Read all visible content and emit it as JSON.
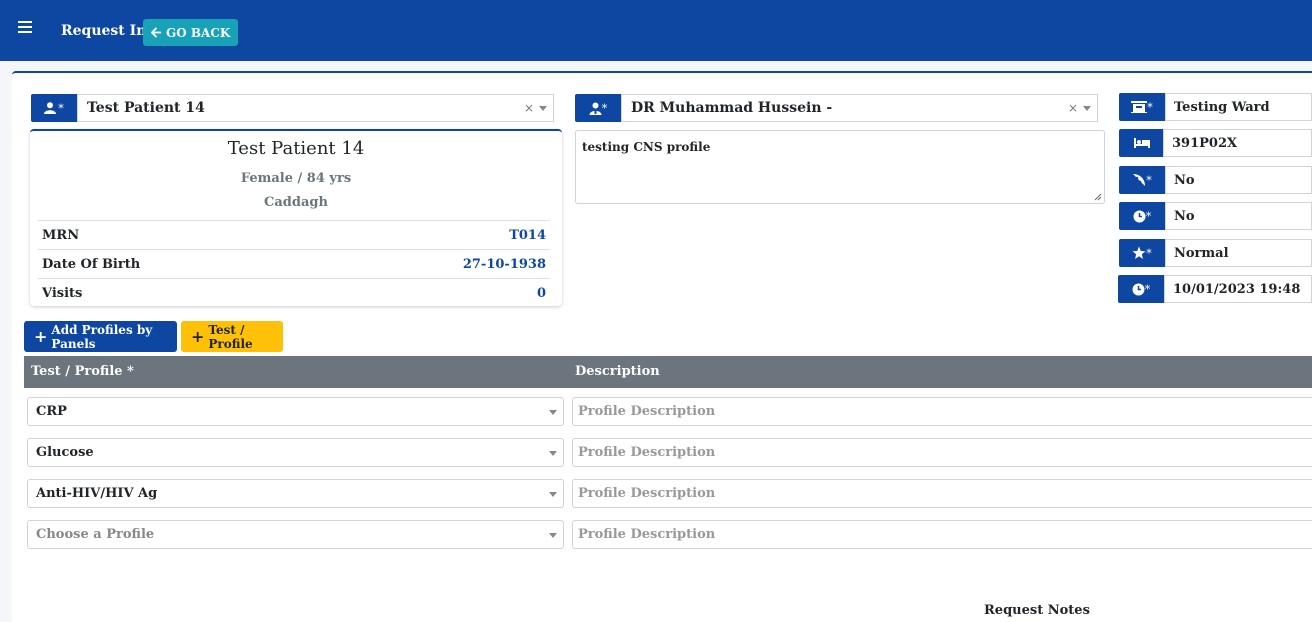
{
  "header": {
    "title": "Request Info",
    "go_back_label": "GO BACK"
  },
  "patient": {
    "selected": "Test Patient 14",
    "addon_icon": "user-icon",
    "name": "Test Patient 14",
    "gender_age": "Female / 84 yrs",
    "location": "Caddagh",
    "rows": [
      {
        "label": "MRN",
        "value": "T014"
      },
      {
        "label": "Date Of Birth",
        "value": "27-10-1938"
      },
      {
        "label": "Visits",
        "value": "0"
      }
    ]
  },
  "doctor": {
    "selected": "DR Muhammad Hussein -",
    "addon_icon": "doctor-icon"
  },
  "clinical_notes": {
    "value": "testing CNS profile"
  },
  "side_fields": [
    {
      "icon": "ward-icon",
      "value": "Testing Ward"
    },
    {
      "icon": "bed-icon",
      "value": "391P02X"
    },
    {
      "icon": "pizza-icon",
      "value": "No"
    },
    {
      "icon": "clock-icon",
      "value": "No"
    },
    {
      "icon": "star-icon",
      "value": "Normal"
    },
    {
      "icon": "clock-icon",
      "value": "10/01/2023 19:48"
    }
  ],
  "actions": {
    "add_profiles_label": "Add Profiles by Panels",
    "test_profile_label": "Test / Profile"
  },
  "table": {
    "col_test": "Test / Profile *",
    "col_description": "Description",
    "rows": [
      {
        "profile": "CRP",
        "description_placeholder": "Profile Description"
      },
      {
        "profile": "Glucose",
        "description_placeholder": "Profile Description"
      },
      {
        "profile": "Anti-HIV/HIV Ag",
        "description_placeholder": "Profile Description"
      },
      {
        "profile": "Choose a Profile",
        "description_placeholder": "Profile Description"
      }
    ]
  },
  "request_notes_label": "Request Notes",
  "colors": {
    "primary": "#0d47a1",
    "info": "#17a2b8",
    "warning": "#ffc107",
    "table_header": "#6c757d"
  }
}
